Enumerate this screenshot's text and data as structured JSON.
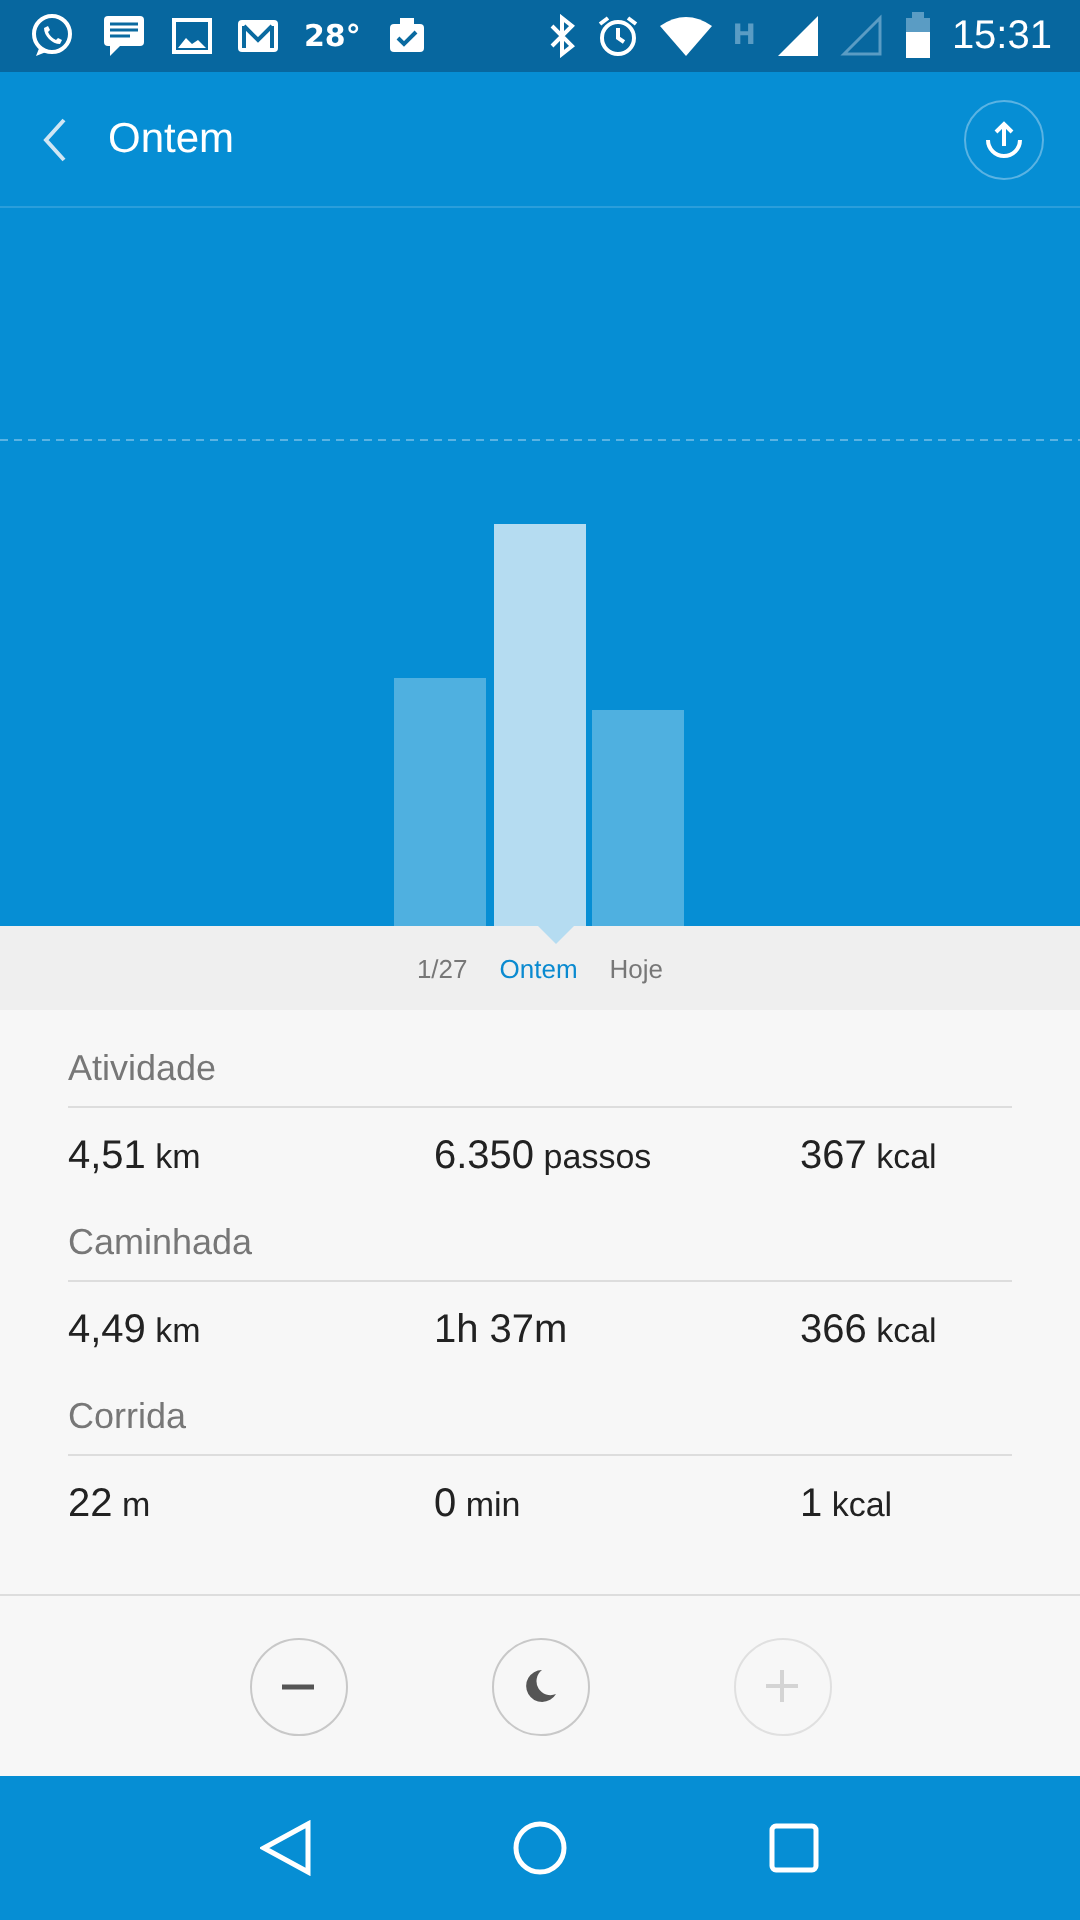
{
  "status_bar": {
    "temperature": "28°",
    "network": "H",
    "time": "15:31"
  },
  "header": {
    "title": "Ontem"
  },
  "dates": [
    {
      "label": "1/27",
      "selected": false
    },
    {
      "label": "Ontem",
      "selected": true
    },
    {
      "label": "Hoje",
      "selected": false
    }
  ],
  "sections": [
    {
      "title": "Atividade",
      "stats": [
        {
          "value": "4,51",
          "unit": "km"
        },
        {
          "value": "6.350",
          "unit": "passos"
        },
        {
          "value": "367",
          "unit": "kcal"
        }
      ]
    },
    {
      "title": "Caminhada",
      "stats": [
        {
          "value": "4,49",
          "unit": "km"
        },
        {
          "value": "1h 37m"
        },
        {
          "value": "366",
          "unit": "kcal"
        }
      ]
    },
    {
      "title": "Corrida",
      "stats": [
        {
          "value": "22",
          "unit": "m"
        },
        {
          "value": "0",
          "unit": "min"
        },
        {
          "value": "1",
          "unit": "kcal"
        }
      ]
    }
  ],
  "controls": [
    {
      "kind": "minus",
      "disabled": false
    },
    {
      "kind": "moon",
      "disabled": false
    },
    {
      "kind": "plus",
      "disabled": true
    }
  ]
}
